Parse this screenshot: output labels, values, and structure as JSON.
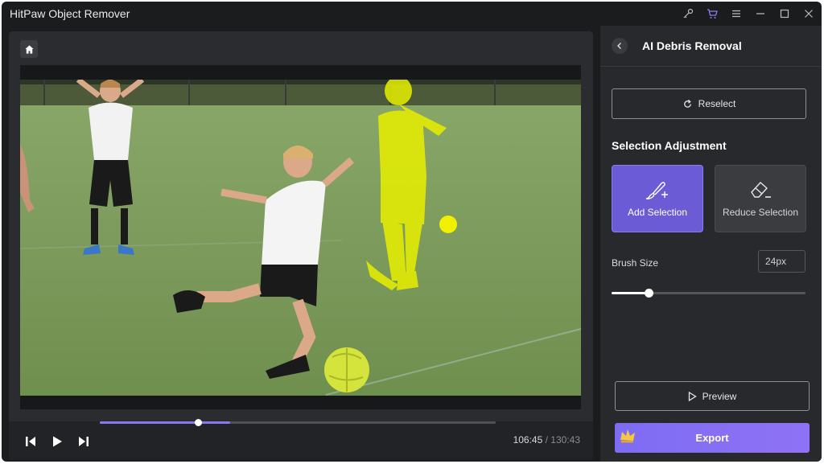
{
  "app": {
    "title": "HitPaw Object Remover"
  },
  "titlebar_icons": [
    "key-icon",
    "cart-icon",
    "menu-icon",
    "minimize-icon",
    "maximize-icon",
    "close-icon"
  ],
  "player": {
    "current_time": "106:45",
    "separator": "/",
    "total_time": "130:43",
    "progress": 0.248,
    "buffered": 0.33
  },
  "panel": {
    "title": "AI Debris Removal",
    "reselect_label": "Reselect",
    "section_title": "Selection Adjustment",
    "add_selection_label": "Add Selection",
    "reduce_selection_label": "Reduce Selection",
    "brush_size_label": "Brush Size",
    "brush_size_value": "24px",
    "brush_size_level": 0.19,
    "preview_label": "Preview",
    "export_label": "Export"
  },
  "colors": {
    "accent": "#7d6cf3",
    "selection_highlight": "#e8f000"
  }
}
